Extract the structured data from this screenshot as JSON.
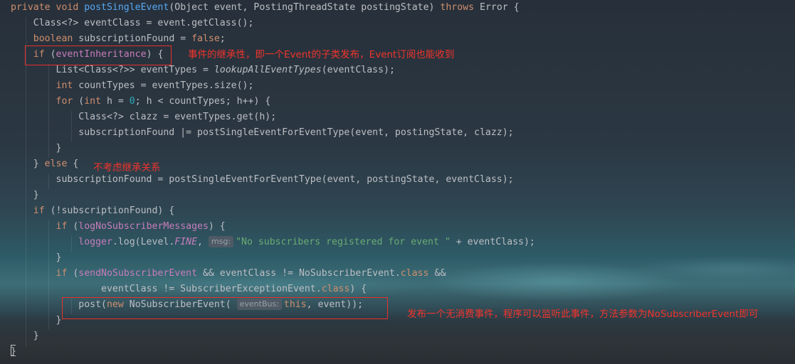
{
  "code": {
    "l1_mod": "private void ",
    "l1_name": "postSingleEvent",
    "l1_params": "(Object event, PostingThreadState postingState) ",
    "l1_throws": "throws",
    "l1_end": " Error {",
    "l2": "    Class<?> eventClass = event.getClass();",
    "l3_kw": "    boolean",
    "l3_mid": " subscriptionFound = ",
    "l3_val": "false",
    "l3_end": ";",
    "l4_kw": "    if",
    "l4_open": " (",
    "l4_field": "eventInheritance",
    "l4_end": ") {",
    "l5_a": "        List<Class<?>> eventTypes = ",
    "l5_call": "lookupAllEventTypes",
    "l5_b": "(eventClass);",
    "l6_kw": "        int",
    "l6_rest": " countTypes = eventTypes.size();",
    "l7_kw": "        for",
    "l7_a": " (",
    "l7_kw2": "int",
    "l7_b": " h = ",
    "l7_num": "0",
    "l7_c": "; h < countTypes; h++) {",
    "l8": "            Class<?> clazz = eventTypes.get(h);",
    "l9": "            subscriptionFound |= postSingleEventForEventType(event, postingState, clazz);",
    "l10": "        }",
    "l11_a": "    } ",
    "l11_kw": "else",
    "l11_b": " {",
    "l12": "        subscriptionFound = postSingleEventForEventType(event, postingState, eventClass);",
    "l13": "    }",
    "l14_kw": "    if",
    "l14_rest": " (!subscriptionFound) {",
    "l15_kw": "        if",
    "l15_a": " (",
    "l15_field": "logNoSubscriberMessages",
    "l15_b": ") {",
    "l16_field": "            logger",
    "l16_a": ".log(Level.",
    "l16_const": "FINE",
    "l16_b": ", ",
    "l16_hint": "msg:",
    "l16_str": "\"No subscribers registered for event \"",
    "l16_c": " + eventClass);",
    "l17": "        }",
    "l18_kw": "        if",
    "l18_a": " (",
    "l18_field": "sendNoSubscriberEvent",
    "l18_b": " && eventClass != NoSubscriberEvent.",
    "l18_kw2": "class",
    "l18_c": " &&",
    "l19_a": "                eventClass != SubscriberExceptionEvent.",
    "l19_kw": "class",
    "l19_b": ") {",
    "l20_a": "            post(",
    "l20_kw": "new",
    "l20_b": " NoSubscriberEvent( ",
    "l20_hint": "eventBus:",
    "l20_kw2": "this",
    "l20_c": ", event));",
    "l21": "        }",
    "l22": "    }",
    "l23": "}"
  },
  "annotations": {
    "inheritance": "事件的继承性，即一个Event的子类发布，Event订阅也能收到",
    "no_inheritance": "不考虑继承关系",
    "no_subscriber": "发布一个无消费事件，程序可以监听此事件，方法参数为NoSubscriberEvent即可"
  },
  "colors": {
    "annotation": "#f0342c",
    "keyword": "#cf8e6d",
    "method": "#56a8f5",
    "field": "#c77dbb",
    "string": "#6aab73",
    "number": "#2aacb8"
  }
}
